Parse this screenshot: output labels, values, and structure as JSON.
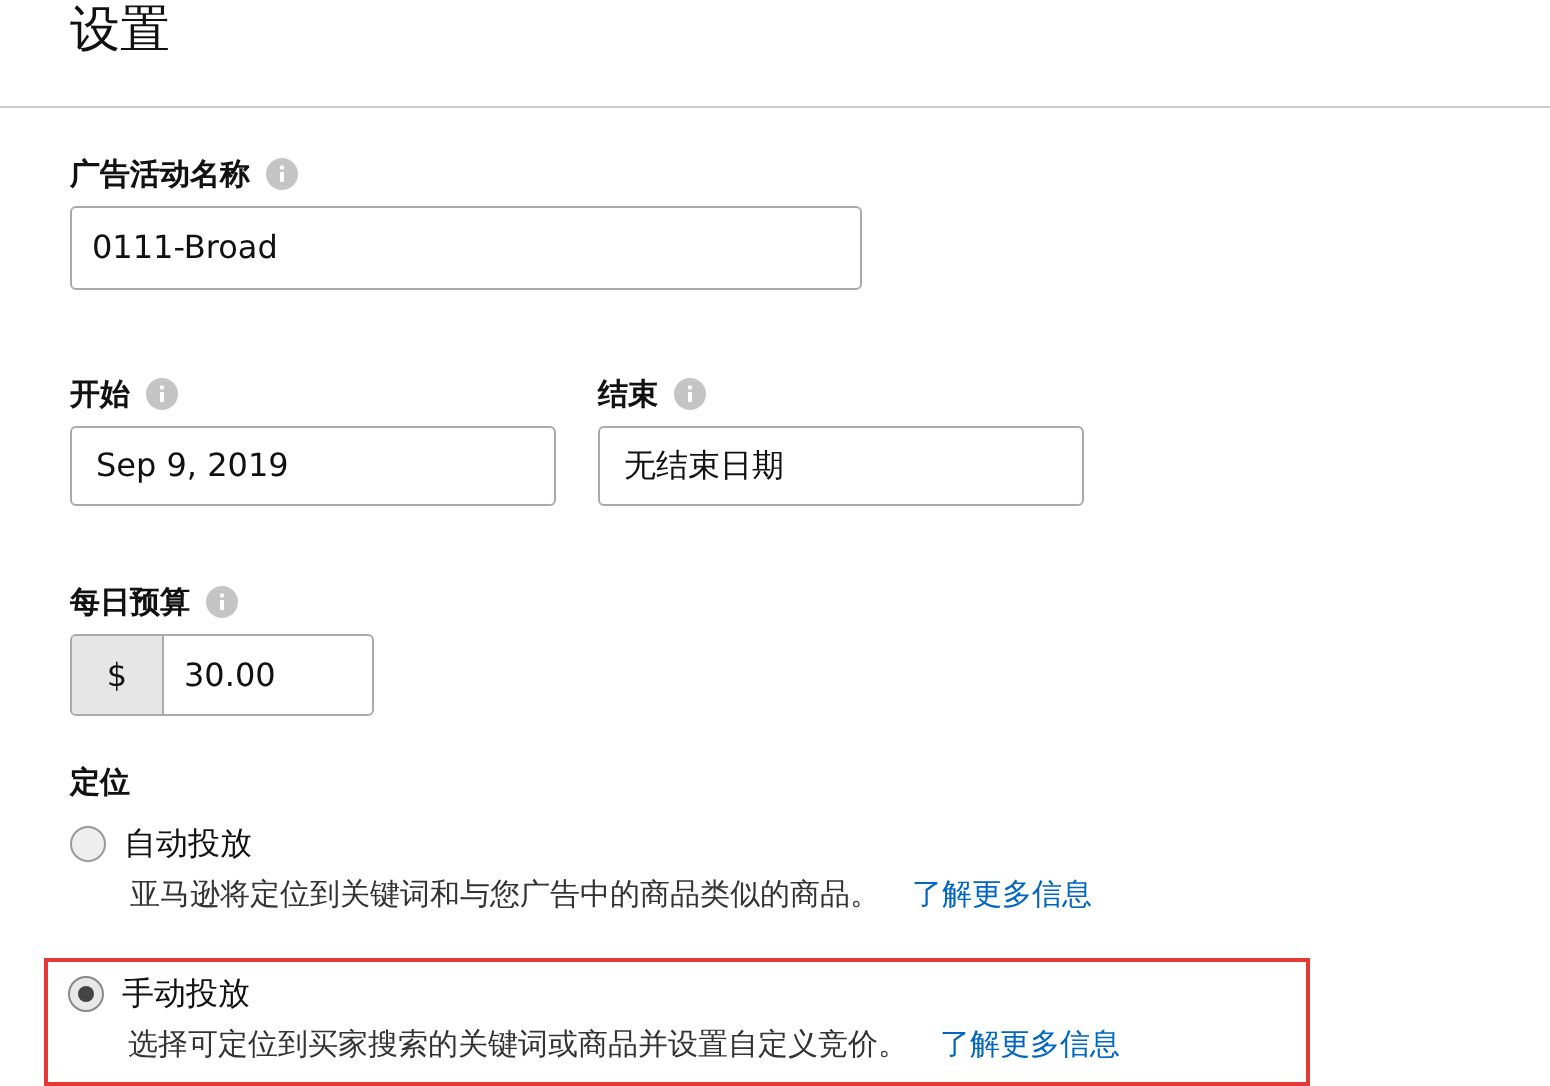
{
  "title": "设置",
  "campaign_name": {
    "label": "广告活动名称",
    "value": "0111-Broad"
  },
  "start": {
    "label": "开始",
    "value": "Sep 9, 2019"
  },
  "end": {
    "label": "结束",
    "value": "无结束日期"
  },
  "budget": {
    "label": "每日预算",
    "prefix": "$",
    "value": "30.00"
  },
  "targeting": {
    "label": "定位",
    "options": [
      {
        "label": "自动投放",
        "description": "亚马逊将定位到关键词和与您广告中的商品类似的商品。",
        "link": "了解更多信息",
        "selected": false,
        "highlighted": false
      },
      {
        "label": "手动投放",
        "description": "选择可定位到买家搜索的关键词或商品并设置自定义竞价。",
        "link": "了解更多信息",
        "selected": true,
        "highlighted": true
      }
    ]
  }
}
